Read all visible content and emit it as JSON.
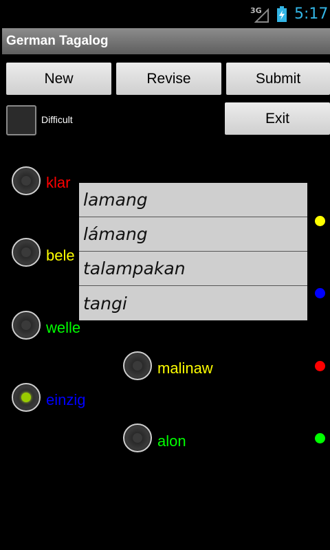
{
  "status": {
    "network": "3G",
    "time": "5:17"
  },
  "title": "German Tagalog",
  "buttons": {
    "new": "New",
    "revise": "Revise",
    "submit": "Submit",
    "exit": "Exit"
  },
  "difficult_label": "Difficult",
  "left_words": [
    {
      "text": "klar",
      "color": "#ff0000",
      "selected": false
    },
    {
      "text": "bele",
      "color": "#ffff00",
      "selected": false
    },
    {
      "text": "welle",
      "color": "#00ff00",
      "selected": false
    },
    {
      "text": "einzig",
      "color": "#0000ff",
      "selected": true
    }
  ],
  "right_words": [
    {
      "text": "malinaw",
      "color": "#ffff00",
      "selected": false
    },
    {
      "text": "alon",
      "color": "#00ff00",
      "selected": false
    }
  ],
  "popup_items": [
    "lamang",
    "lámang",
    "talampakan",
    "tangi"
  ],
  "indicator_dots": [
    "#ffff00",
    "#0000ff",
    "#ff0000",
    "#00ff00"
  ]
}
